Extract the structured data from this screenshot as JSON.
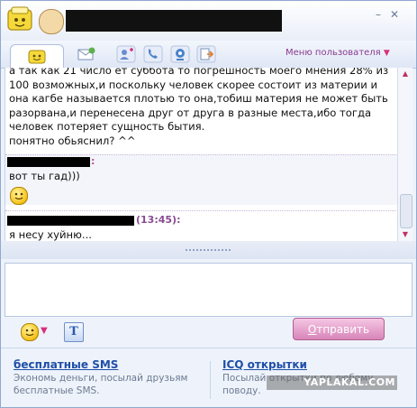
{
  "title_bar": {
    "contact_name": "",
    "minimize_label": "–",
    "close_label": "✕"
  },
  "toolbar": {
    "user_menu_label": "Меню пользователя",
    "user_menu_arrow": "▼"
  },
  "chat": {
    "messages": [
      {
        "text": "а так как 21 число ет суббота то погрешность моего мнения 28% из 100 возможных,и поскольку человек скорее состоит из материи и она кагбе называется плотью то она,тобиш материя не может быть разорвана,и перенесена друг от друга в разные места,ибо тогда человек потеряет сущность бытия.\nпонятно обьяснил? ^^"
      },
      {
        "colon": ":",
        "text": "вот ты гад)))",
        "emoticon": "smiley"
      },
      {
        "time": "(13:45):",
        "text": "я несу хуйню..."
      }
    ]
  },
  "input": {
    "value": "",
    "placeholder": ""
  },
  "bottom_toolbar": {
    "smile_dropdown_arrow": "▼",
    "format_label": "T",
    "send_label_first": "О",
    "send_label_rest": "тправить"
  },
  "promo": {
    "left_link": "бесплатные SMS",
    "left_desc": "Экономь деньги, посылай друзьям бесплатные SMS.",
    "right_link": "ICQ открытки",
    "right_desc": "Посылай открытки по любому поводу."
  },
  "watermark": "YAPLAKAL.COM",
  "colors": {
    "accent_pink": "#d785b8",
    "link_blue": "#1f4fa7",
    "menu_purple": "#8a3a8f",
    "window_border": "#8fa9cf"
  }
}
